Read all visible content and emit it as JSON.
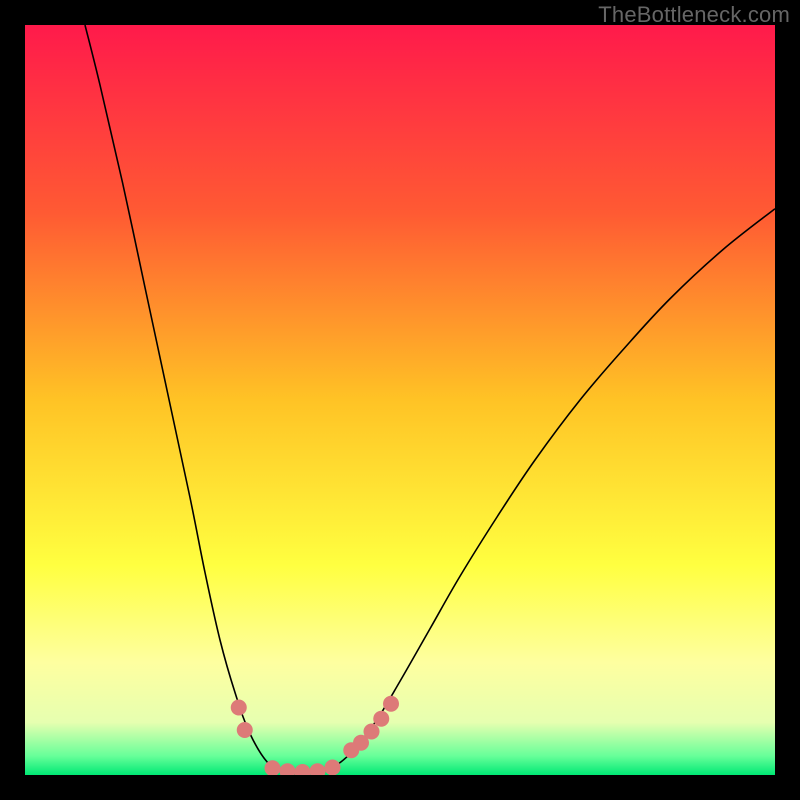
{
  "watermark": "TheBottleneck.com",
  "chart_data": {
    "type": "line",
    "title": "",
    "xlabel": "",
    "ylabel": "",
    "xlim": [
      0,
      100
    ],
    "ylim": [
      0,
      100
    ],
    "grid": false,
    "legend": false,
    "background_gradient": {
      "stops": [
        {
          "offset": 0.0,
          "color": "#ff1a4b"
        },
        {
          "offset": 0.25,
          "color": "#ff5a33"
        },
        {
          "offset": 0.5,
          "color": "#ffc325"
        },
        {
          "offset": 0.72,
          "color": "#ffff40"
        },
        {
          "offset": 0.85,
          "color": "#feffa0"
        },
        {
          "offset": 0.93,
          "color": "#e6ffb0"
        },
        {
          "offset": 0.975,
          "color": "#66ff99"
        },
        {
          "offset": 1.0,
          "color": "#00e874"
        }
      ]
    },
    "series": [
      {
        "name": "curve",
        "stroke": "#000000",
        "stroke_width": 1.6,
        "points": [
          {
            "x": 8.0,
            "y": 100.0
          },
          {
            "x": 10.0,
            "y": 92.0
          },
          {
            "x": 13.0,
            "y": 79.0
          },
          {
            "x": 16.0,
            "y": 65.0
          },
          {
            "x": 19.0,
            "y": 51.0
          },
          {
            "x": 22.0,
            "y": 37.0
          },
          {
            "x": 24.0,
            "y": 27.0
          },
          {
            "x": 26.0,
            "y": 18.0
          },
          {
            "x": 28.0,
            "y": 11.0
          },
          {
            "x": 30.0,
            "y": 5.5
          },
          {
            "x": 32.5,
            "y": 1.5
          },
          {
            "x": 35.0,
            "y": 0.3
          },
          {
            "x": 38.0,
            "y": 0.3
          },
          {
            "x": 41.0,
            "y": 1.0
          },
          {
            "x": 44.0,
            "y": 3.5
          },
          {
            "x": 47.0,
            "y": 7.5
          },
          {
            "x": 50.0,
            "y": 12.5
          },
          {
            "x": 54.0,
            "y": 19.5
          },
          {
            "x": 58.0,
            "y": 26.5
          },
          {
            "x": 63.0,
            "y": 34.5
          },
          {
            "x": 68.0,
            "y": 42.0
          },
          {
            "x": 74.0,
            "y": 50.0
          },
          {
            "x": 80.0,
            "y": 57.0
          },
          {
            "x": 86.0,
            "y": 63.5
          },
          {
            "x": 93.0,
            "y": 70.0
          },
          {
            "x": 100.0,
            "y": 75.5
          }
        ]
      },
      {
        "name": "markers-left",
        "type": "scatter",
        "color": "#dd7a78",
        "radius": 8,
        "points": [
          {
            "x": 28.5,
            "y": 9.0
          },
          {
            "x": 29.3,
            "y": 6.0
          }
        ]
      },
      {
        "name": "markers-right",
        "type": "scatter",
        "color": "#dd7a78",
        "radius": 8,
        "points": [
          {
            "x": 43.5,
            "y": 3.3
          },
          {
            "x": 44.8,
            "y": 4.3
          },
          {
            "x": 46.2,
            "y": 5.8
          },
          {
            "x": 47.5,
            "y": 7.5
          },
          {
            "x": 48.8,
            "y": 9.5
          }
        ]
      },
      {
        "name": "markers-bottom",
        "type": "scatter",
        "color": "#dd7a78",
        "radius": 8,
        "points": [
          {
            "x": 33.0,
            "y": 0.9
          },
          {
            "x": 35.0,
            "y": 0.5
          },
          {
            "x": 37.0,
            "y": 0.4
          },
          {
            "x": 39.0,
            "y": 0.5
          },
          {
            "x": 41.0,
            "y": 1.0
          }
        ]
      }
    ]
  }
}
